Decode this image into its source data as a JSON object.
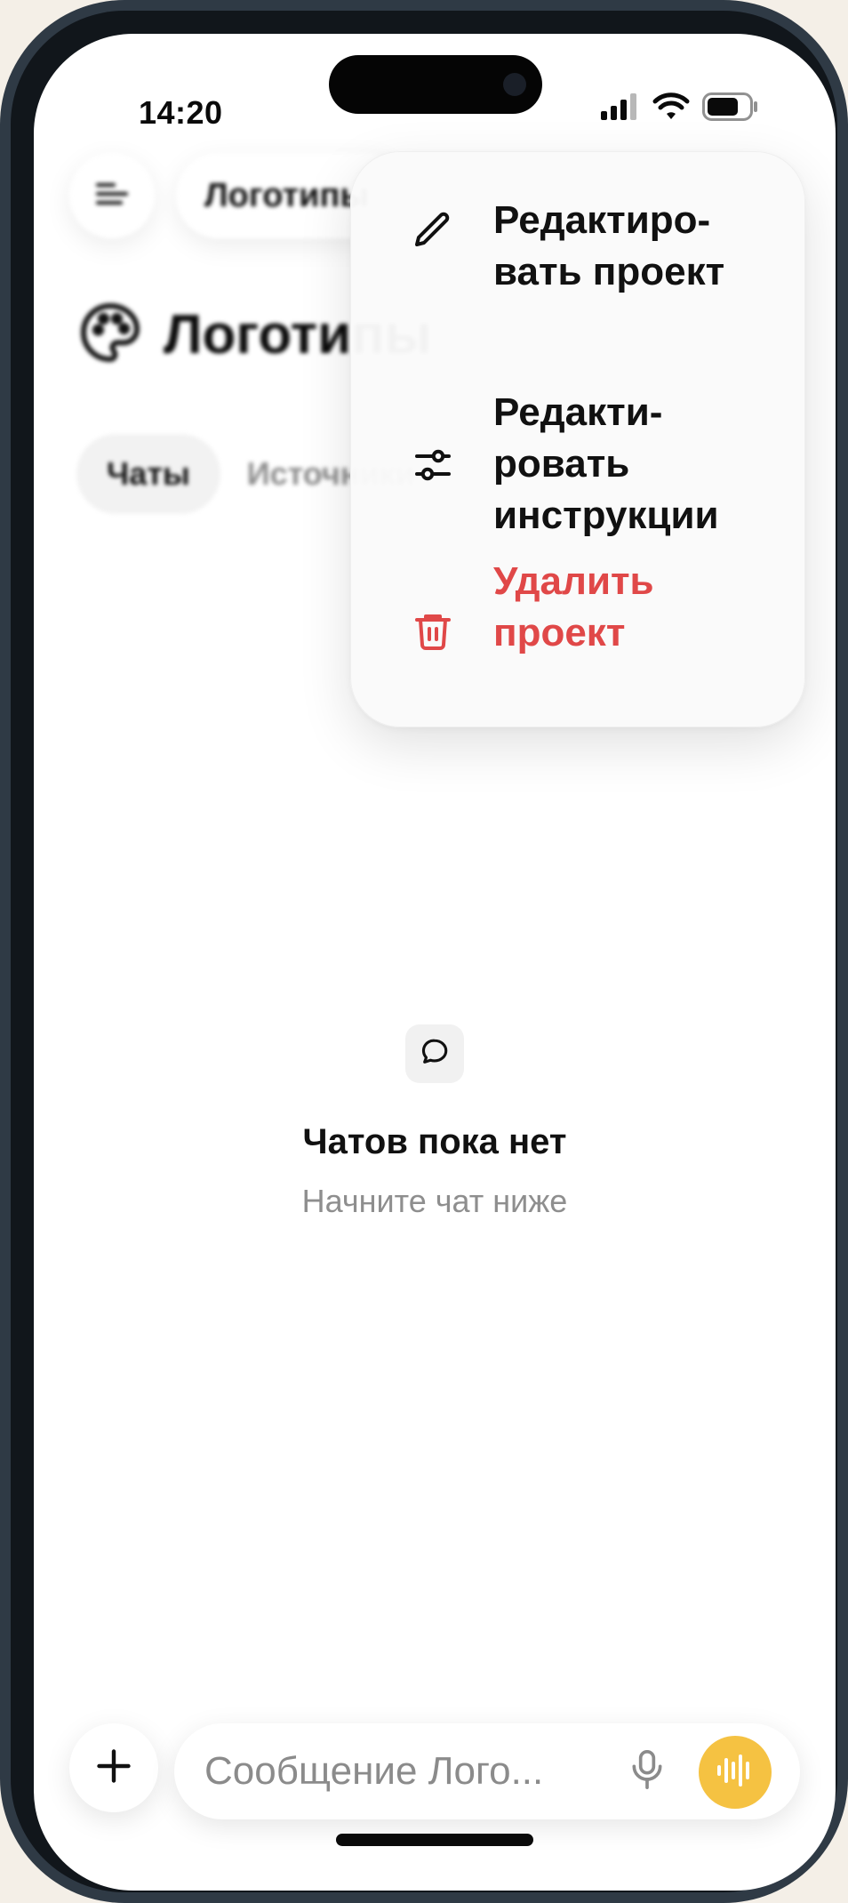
{
  "status_bar": {
    "time": "14:20",
    "icons": [
      "cellular-signal-icon",
      "wifi-icon",
      "battery-icon"
    ]
  },
  "header": {
    "menu_icon": "hamburger-menu-icon",
    "breadcrumb": "Логотипы"
  },
  "project": {
    "icon": "palette-icon",
    "title": "Логотипы"
  },
  "tabs": [
    {
      "label": "Чаты",
      "active": true
    },
    {
      "label": "Источники",
      "active": false
    }
  ],
  "dropdown_menu": {
    "items": [
      {
        "label": "Редактиро-вать проект",
        "icon": "pencil-icon",
        "color": "#111111"
      },
      {
        "label": "Редакти-ровать инструкции",
        "icon": "sliders-icon",
        "color": "#111111"
      },
      {
        "label": "Удалить проект",
        "icon": "trash-icon",
        "color": "#e04848"
      }
    ]
  },
  "empty_state": {
    "icon": "chat-bubble-icon",
    "title": "Чатов пока нет",
    "subtitle": "Начните чат ниже"
  },
  "composer": {
    "add_icon": "plus-icon",
    "placeholder": "Сообщение Лого...",
    "value": "",
    "mic_icon": "microphone-icon",
    "voice_icon": "voice-waveform-icon",
    "voice_button_color": "#f5c242"
  }
}
